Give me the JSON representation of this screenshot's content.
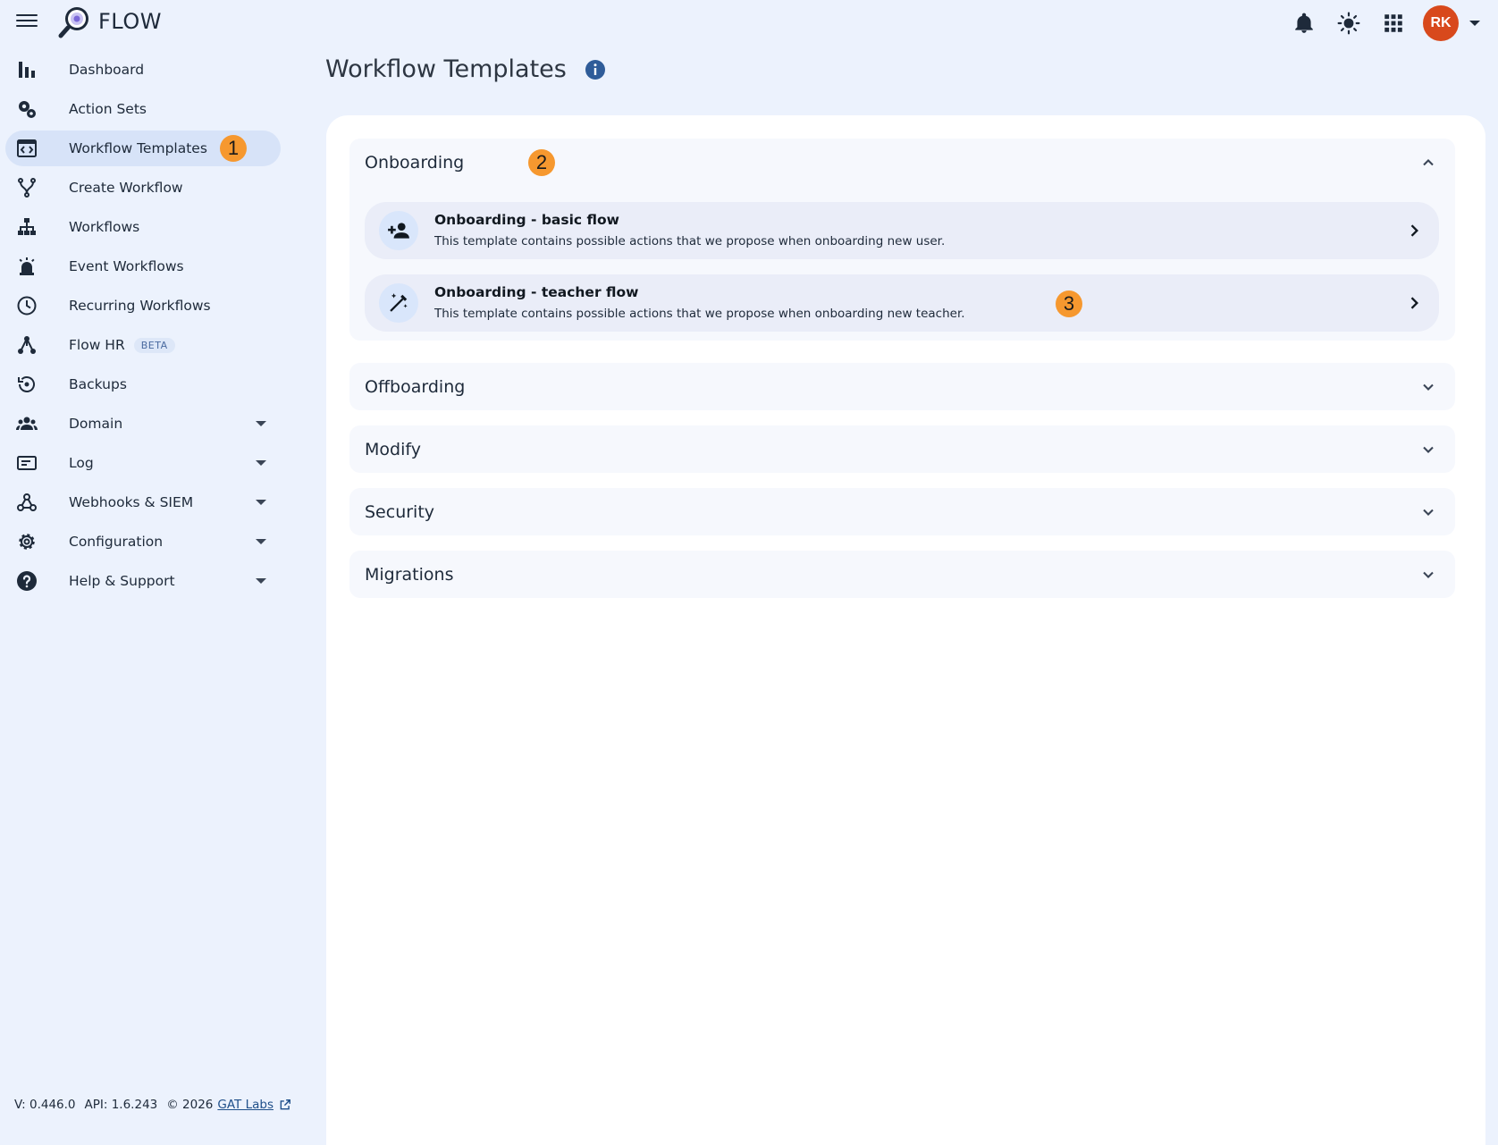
{
  "app": {
    "name": "FLOW"
  },
  "user": {
    "initials": "RK",
    "avatar_color": "#d8491c"
  },
  "sidebar": {
    "items": [
      {
        "label": "Dashboard"
      },
      {
        "label": "Action Sets"
      },
      {
        "label": "Workflow Templates",
        "active": true,
        "badge": "1"
      },
      {
        "label": "Create Workflow"
      },
      {
        "label": "Workflows"
      },
      {
        "label": "Event Workflows"
      },
      {
        "label": "Recurring Workflows"
      },
      {
        "label": "Flow HR",
        "tag": "BETA"
      },
      {
        "label": "Backups"
      },
      {
        "label": "Domain",
        "expandable": true
      },
      {
        "label": "Log",
        "expandable": true
      },
      {
        "label": "Webhooks & SIEM",
        "expandable": true
      },
      {
        "label": "Configuration",
        "expandable": true
      },
      {
        "label": "Help & Support",
        "expandable": true
      }
    ]
  },
  "footer": {
    "version": "V: 0.446.0",
    "api": "API: 1.6.243",
    "copyright": "© 2026",
    "link": "GAT Labs"
  },
  "page": {
    "title": "Workflow Templates"
  },
  "sections": [
    {
      "title": "Onboarding",
      "expanded": true,
      "badge": "2",
      "templates": [
        {
          "title": "Onboarding - basic flow",
          "description": "This template contains possible actions that we propose when onboarding new user.",
          "icon": "person-add-icon"
        },
        {
          "title": "Onboarding - teacher flow",
          "description": "This template contains possible actions that we propose when onboarding new teacher.",
          "icon": "magic-wand-icon",
          "badge": "3"
        }
      ]
    },
    {
      "title": "Offboarding",
      "expanded": false
    },
    {
      "title": "Modify",
      "expanded": false
    },
    {
      "title": "Security",
      "expanded": false
    },
    {
      "title": "Migrations",
      "expanded": false
    }
  ],
  "colors": {
    "background": "#ecf2fd",
    "active_nav": "#d7e3f8",
    "badge": "#f6982f",
    "card": "#ffffff",
    "accent_info": "#2f5c99"
  }
}
